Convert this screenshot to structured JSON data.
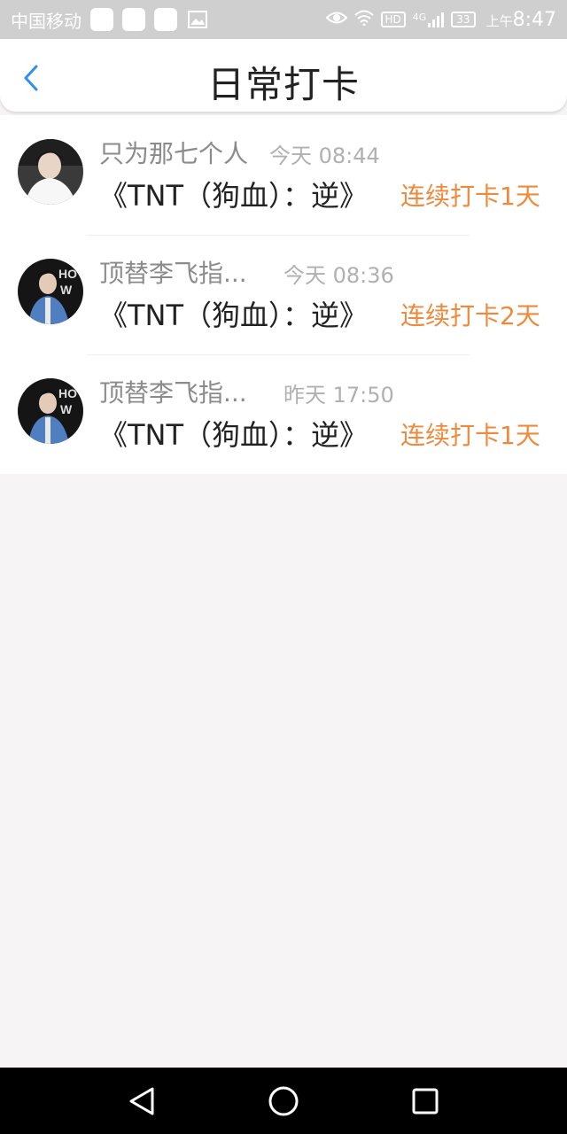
{
  "status_bar": {
    "carrier": "中国移动",
    "network": "4G",
    "hd": "HD",
    "battery": "33",
    "time_prefix": "上午",
    "time": "8:47"
  },
  "header": {
    "title": "日常打卡",
    "back_icon": "chevron-left-icon",
    "accent_color": "#2f8ef2"
  },
  "checkins": [
    {
      "name": "只为那七个人",
      "time": "今天 08:44",
      "book": "《TNT（狗血）：逆》",
      "streak": "连续打卡1天"
    },
    {
      "name": "顶替李飞指...",
      "time": "今天 08:36",
      "book": "《TNT（狗血）：逆》",
      "streak": "连续打卡2天"
    },
    {
      "name": "顶替李飞指...",
      "time": "昨天 17:50",
      "book": "《TNT（狗血）：逆》",
      "streak": "连续打卡1天"
    }
  ],
  "colors": {
    "streak": "#ef8a3c",
    "name": "#8b8b8b",
    "time": "#b0b0b0"
  }
}
